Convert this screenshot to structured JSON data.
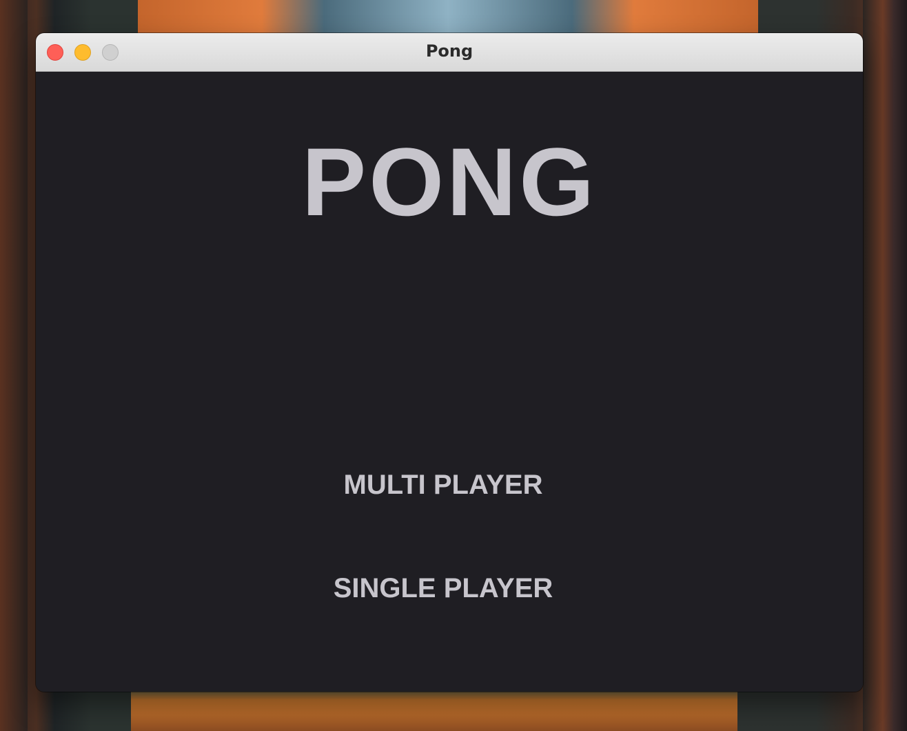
{
  "window": {
    "title": "Pong"
  },
  "game": {
    "title": "PONG",
    "menu": {
      "multi_player": "MULTI PLAYER",
      "single_player": "SINGLE PLAYER"
    }
  },
  "colors": {
    "background": "#1f1e23",
    "text": "#c7c5cc",
    "close": "#fe5f57",
    "minimize": "#febc2e",
    "zoom": "#d0d0d0"
  },
  "icons": [
    "close-icon",
    "minimize-icon",
    "zoom-icon"
  ]
}
